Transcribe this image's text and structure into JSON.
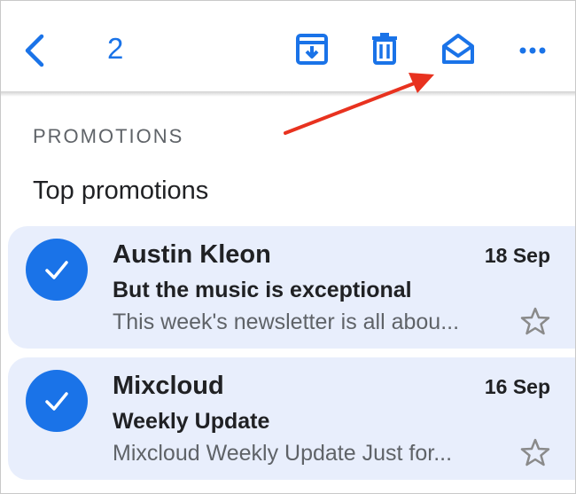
{
  "toolbar": {
    "selected_count": "2",
    "actions": [
      "back",
      "archive",
      "delete",
      "mark-as-read",
      "more"
    ]
  },
  "section": {
    "label": "PROMOTIONS",
    "subheading": "Top promotions"
  },
  "emails": [
    {
      "sender": "Austin Kleon",
      "date": "18 Sep",
      "subject": "But the music is exceptional",
      "snippet": "This week's newsletter is all abou...",
      "selected": true,
      "starred": false
    },
    {
      "sender": "Mixcloud",
      "date": "16 Sep",
      "subject": "Weekly Update",
      "snippet": "Mixcloud Weekly Update Just for...",
      "selected": true,
      "starred": false
    }
  ],
  "colors": {
    "accent": "#1a73e8",
    "selected_row": "#e8eefc",
    "annotation_arrow": "#e8321f"
  }
}
